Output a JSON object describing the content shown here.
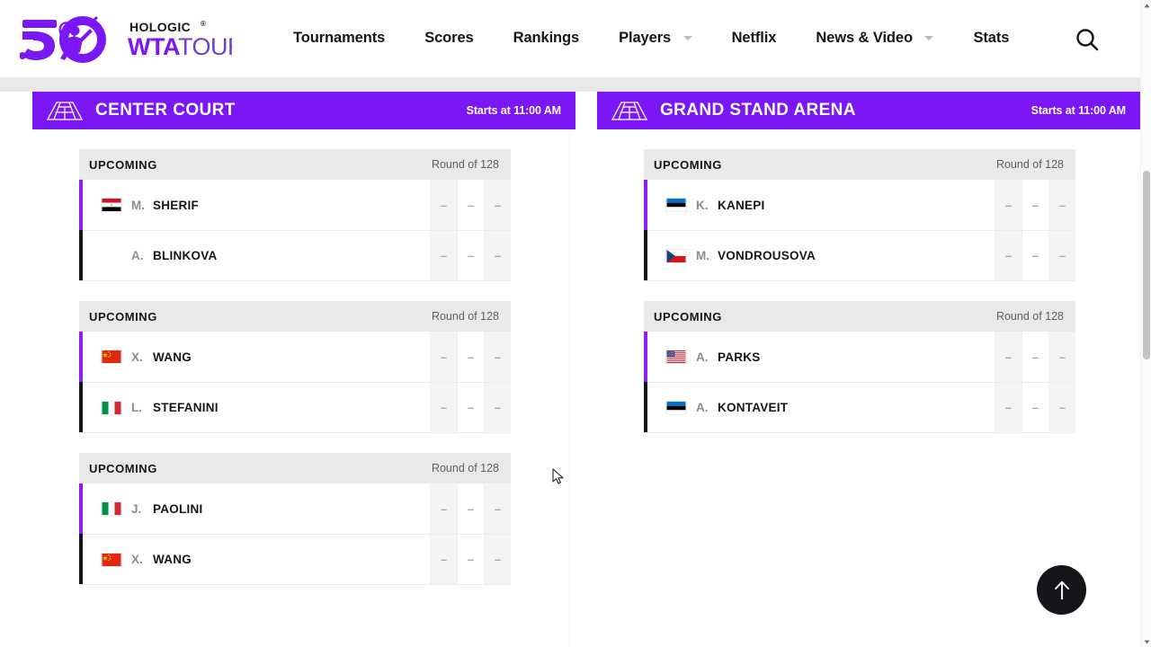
{
  "header": {
    "logo": {
      "anniversary": "50",
      "brand_top": "HOLOGIC®",
      "brand_wta": "WTA",
      "brand_tour": "TOUR",
      "icon": "wta-50-logo"
    },
    "nav_items": [
      {
        "label": "Tournaments",
        "has_dropdown": false,
        "name": "nav-tournaments"
      },
      {
        "label": "Scores",
        "has_dropdown": false,
        "name": "nav-scores"
      },
      {
        "label": "Rankings",
        "has_dropdown": false,
        "name": "nav-rankings"
      },
      {
        "label": "Players",
        "has_dropdown": true,
        "name": "nav-players"
      },
      {
        "label": "Netflix",
        "has_dropdown": false,
        "name": "nav-netflix"
      },
      {
        "label": "News & Video",
        "has_dropdown": true,
        "name": "nav-news-video"
      },
      {
        "label": "Stats",
        "has_dropdown": false,
        "name": "nav-stats"
      }
    ],
    "search_icon": "search-icon"
  },
  "colors": {
    "brand_purple": "#7b17f5",
    "accent_purple": "#8b1ff5",
    "accent_black": "#16161a",
    "card_header_grey": "#e9e9e9",
    "score_cell_grey": "#f4f4f4"
  },
  "courts": [
    {
      "name": "CENTER COURT",
      "start_time": "Starts at 11:00 AM",
      "icon": "tennis-court-icon",
      "matches": [
        {
          "status": "UPCOMING",
          "round": "Round of 128",
          "players": [
            {
              "initial": "M.",
              "name": "SHERIF",
              "flag": "EGY",
              "scores": [
                "–",
                "–",
                "–"
              ]
            },
            {
              "initial": "A.",
              "name": "BLINKOVA",
              "flag": "",
              "scores": [
                "–",
                "–",
                "–"
              ]
            }
          ]
        },
        {
          "status": "UPCOMING",
          "round": "Round of 128",
          "players": [
            {
              "initial": "X.",
              "name": "WANG",
              "flag": "CHN",
              "scores": [
                "–",
                "–",
                "–"
              ]
            },
            {
              "initial": "L.",
              "name": "STEFANINI",
              "flag": "ITA",
              "scores": [
                "–",
                "–",
                "–"
              ]
            }
          ]
        },
        {
          "status": "UPCOMING",
          "round": "Round of 128",
          "players": [
            {
              "initial": "J.",
              "name": "PAOLINI",
              "flag": "ITA",
              "scores": [
                "–",
                "–",
                "–"
              ]
            },
            {
              "initial": "X.",
              "name": "WANG",
              "flag": "CHN",
              "scores": [
                "–",
                "–",
                "–"
              ]
            }
          ]
        }
      ]
    },
    {
      "name": "GRAND STAND ARENA",
      "start_time": "Starts at 11:00 AM",
      "icon": "tennis-court-icon",
      "matches": [
        {
          "status": "UPCOMING",
          "round": "Round of 128",
          "players": [
            {
              "initial": "K.",
              "name": "KANEPI",
              "flag": "EST",
              "scores": [
                "–",
                "–",
                "–"
              ]
            },
            {
              "initial": "M.",
              "name": "VONDROUSOVA",
              "flag": "CZE",
              "scores": [
                "–",
                "–",
                "–"
              ]
            }
          ]
        },
        {
          "status": "UPCOMING",
          "round": "Round of 128",
          "players": [
            {
              "initial": "A.",
              "name": "PARKS",
              "flag": "USA",
              "scores": [
                "–",
                "–",
                "–"
              ]
            },
            {
              "initial": "A.",
              "name": "KONTAVEIT",
              "flag": "EST",
              "scores": [
                "–",
                "–",
                "–"
              ]
            }
          ]
        }
      ]
    }
  ],
  "back_to_top": {
    "icon": "arrow-up-icon",
    "label": ""
  },
  "scrollbar": {
    "up_icon": "scroll-up-arrow",
    "down_icon": "scroll-down-arrow"
  }
}
